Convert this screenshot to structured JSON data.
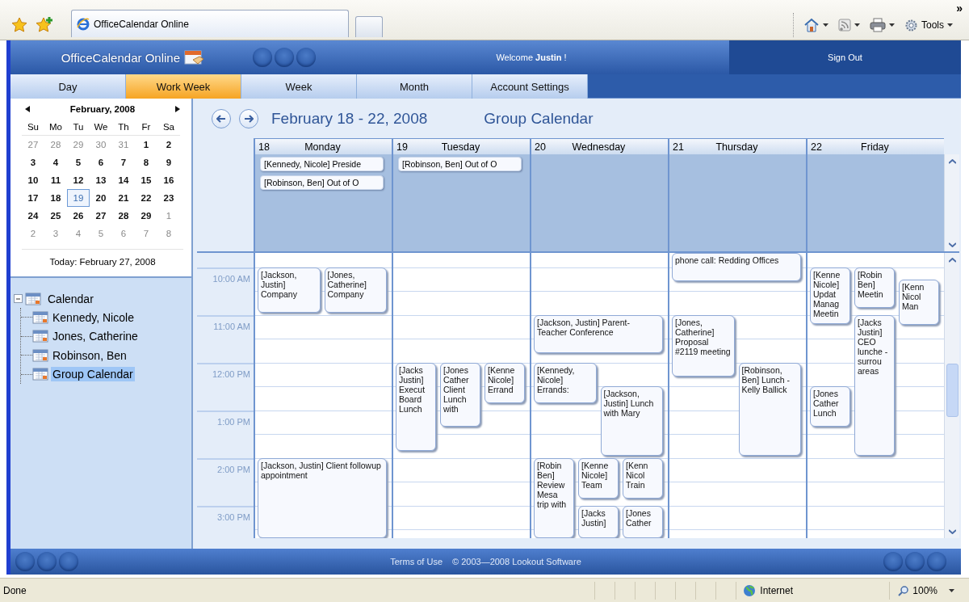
{
  "browser": {
    "tab_title": "OfficeCalendar Online",
    "tools_label": "Tools",
    "overflow": "»"
  },
  "header": {
    "logo": "OfficeCalendar Online",
    "welcome": "Welcome **Justin** !",
    "sign_out": "Sign Out"
  },
  "tabs": [
    {
      "label": "Day",
      "selected": false
    },
    {
      "label": "Work Week",
      "selected": true
    },
    {
      "label": "Week",
      "selected": false
    },
    {
      "label": "Month",
      "selected": false
    },
    {
      "label": "Account Settings",
      "selected": false
    }
  ],
  "mini_calendar": {
    "title": "February, 2008",
    "weekdays": [
      "Su",
      "Mo",
      "Tu",
      "We",
      "Th",
      "Fr",
      "Sa"
    ],
    "weeks": [
      [
        {
          "day": "27",
          "other_month": true,
          "selected": false
        },
        {
          "day": "28",
          "other_month": true,
          "selected": false
        },
        {
          "day": "29",
          "other_month": true,
          "selected": false
        },
        {
          "day": "30",
          "other_month": true,
          "selected": false
        },
        {
          "day": "31",
          "other_month": true,
          "selected": false
        },
        {
          "day": "1",
          "other_month": false,
          "selected": false
        },
        {
          "day": "2",
          "other_month": false,
          "selected": false
        }
      ],
      [
        {
          "day": "3",
          "other_month": false,
          "selected": false
        },
        {
          "day": "4",
          "other_month": false,
          "selected": false
        },
        {
          "day": "5",
          "other_month": false,
          "selected": false
        },
        {
          "day": "6",
          "other_month": false,
          "selected": false
        },
        {
          "day": "7",
          "other_month": false,
          "selected": false
        },
        {
          "day": "8",
          "other_month": false,
          "selected": false
        },
        {
          "day": "9",
          "other_month": false,
          "selected": false
        }
      ],
      [
        {
          "day": "10",
          "other_month": false,
          "selected": false
        },
        {
          "day": "11",
          "other_month": false,
          "selected": false
        },
        {
          "day": "12",
          "other_month": false,
          "selected": false
        },
        {
          "day": "13",
          "other_month": false,
          "selected": false
        },
        {
          "day": "14",
          "other_month": false,
          "selected": false
        },
        {
          "day": "15",
          "other_month": false,
          "selected": false
        },
        {
          "day": "16",
          "other_month": false,
          "selected": false
        }
      ],
      [
        {
          "day": "17",
          "other_month": false,
          "selected": false
        },
        {
          "day": "18",
          "other_month": false,
          "selected": false
        },
        {
          "day": "19",
          "other_month": false,
          "selected": true
        },
        {
          "day": "20",
          "other_month": false,
          "selected": false
        },
        {
          "day": "21",
          "other_month": false,
          "selected": false
        },
        {
          "day": "22",
          "other_month": false,
          "selected": false
        },
        {
          "day": "23",
          "other_month": false,
          "selected": false
        }
      ],
      [
        {
          "day": "24",
          "other_month": false,
          "selected": false
        },
        {
          "day": "25",
          "other_month": false,
          "selected": false
        },
        {
          "day": "26",
          "other_month": false,
          "selected": false
        },
        {
          "day": "27",
          "other_month": false,
          "selected": false
        },
        {
          "day": "28",
          "other_month": false,
          "selected": false
        },
        {
          "day": "29",
          "other_month": false,
          "selected": false
        },
        {
          "day": "1",
          "other_month": true,
          "selected": false
        }
      ],
      [
        {
          "day": "2",
          "other_month": true,
          "selected": false
        },
        {
          "day": "3",
          "other_month": true,
          "selected": false
        },
        {
          "day": "4",
          "other_month": true,
          "selected": false
        },
        {
          "day": "5",
          "other_month": true,
          "selected": false
        },
        {
          "day": "6",
          "other_month": true,
          "selected": false
        },
        {
          "day": "7",
          "other_month": true,
          "selected": false
        },
        {
          "day": "8",
          "other_month": true,
          "selected": false
        }
      ]
    ],
    "today": "Today: February 27, 2008"
  },
  "tree": {
    "label": "Calendar",
    "expanded": true,
    "children": [
      {
        "label": "Kennedy, Nicole",
        "selected": false
      },
      {
        "label": "Jones, Catherine",
        "selected": false
      },
      {
        "label": "Robinson, Ben",
        "selected": false
      },
      {
        "label": "Group Calendar",
        "selected": true
      }
    ]
  },
  "view": {
    "range_title": "February 18 - 22, 2008",
    "calendar_name": "Group Calendar",
    "times": [
      "10:00 AM",
      "11:00 AM",
      "12:00 PM",
      "1:00 PM",
      "2:00 PM",
      "3:00 PM"
    ],
    "days": [
      {
        "date": "18",
        "weekday": "Monday",
        "all_day": [
          "[Kennedy, Nicole] Preside",
          "[Robinson, Ben] Out of O"
        ],
        "events": [
          "[Jackson, Justin] Company",
          "[Jones, Catherine] Company",
          "[Jackson, Justin] Client followup appointment"
        ]
      },
      {
        "date": "19",
        "weekday": "Tuesday",
        "all_day": [
          "[Robinson, Ben] Out of O"
        ],
        "events": [
          "[Jacks Justin] Execut Board Lunch",
          "[Jones Cather Client Lunch with",
          "[Kenne Nicole] Errand"
        ]
      },
      {
        "date": "20",
        "weekday": "Wednesday",
        "events": [
          "[Jackson, Justin] Parent-Teacher Conference",
          "[Kennedy, Nicole] Errands:",
          "[Jackson, Justin] Lunch with Mary",
          "[Robin Ben] Review Mesa trip with",
          "[Kenne Nicole] Team",
          "[Kenn Nicol Train",
          "[Jacks Justin]",
          "[Jones Cather"
        ]
      },
      {
        "date": "21",
        "weekday": "Thursday",
        "events": [
          "phone call: Redding Offices",
          "[Jones, Catherine] Proposal #2119 meeting",
          "[Robinson, Ben] Lunch - Kelly Ballick"
        ]
      },
      {
        "date": "22",
        "weekday": "Friday",
        "events": [
          "[Kenne Nicole] Updat Manag Meetin",
          "[Robin Ben] Meetin",
          "[Kenn Nicol Man",
          "[Jacks Justin] CEO lunche - surrou areas",
          "[Jones Cather Lunch"
        ]
      }
    ]
  },
  "footer": {
    "terms": "Terms of Use",
    "copyright": "© 2003—2008 Lookout Software"
  },
  "status_bar": {
    "text": "Done",
    "zone": "Internet",
    "zoom": "100%"
  }
}
